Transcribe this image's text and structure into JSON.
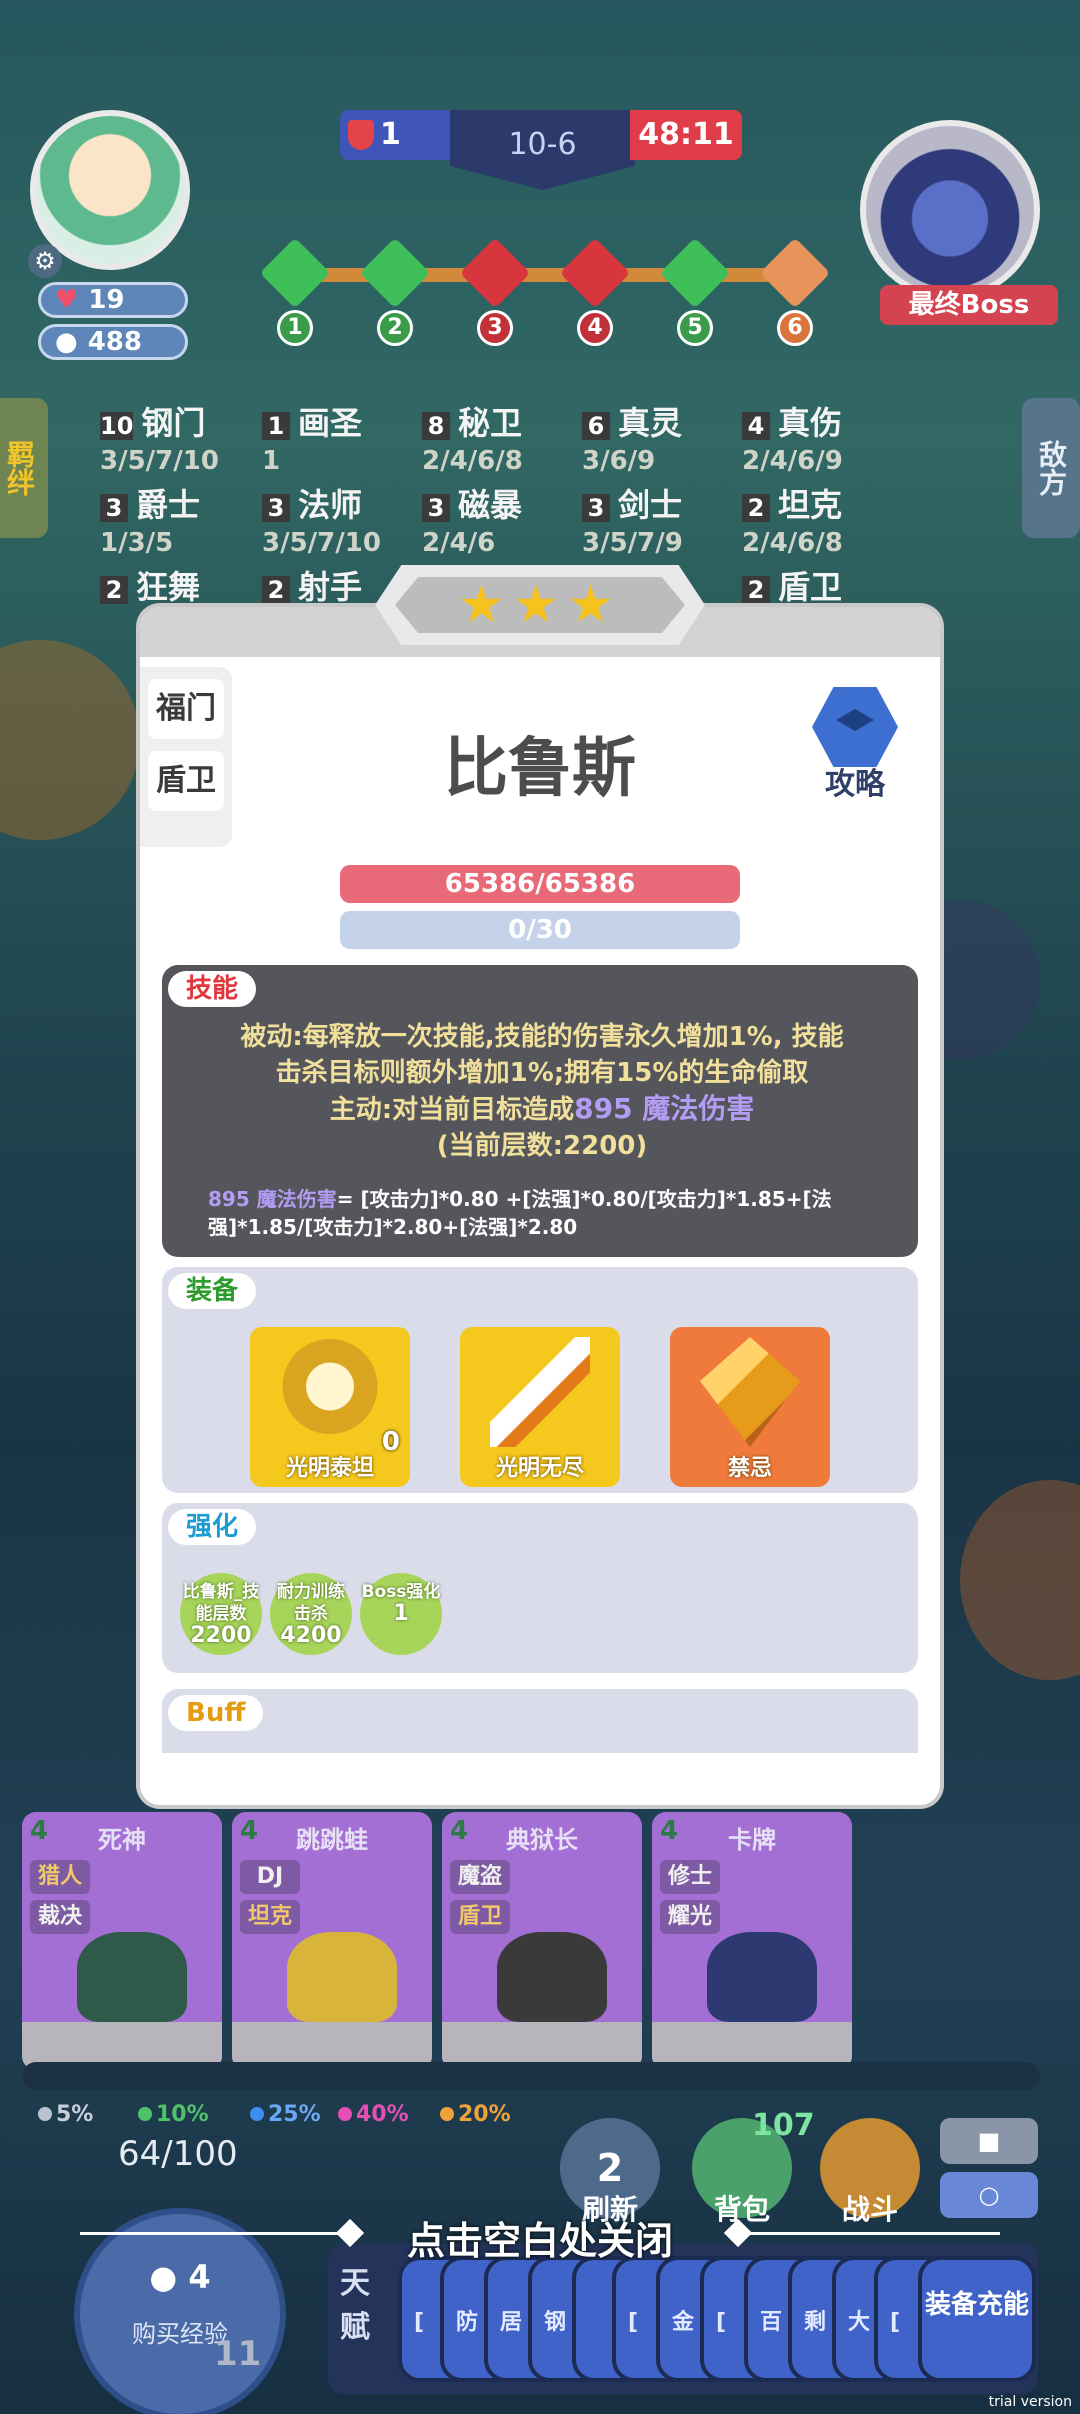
{
  "hud": {
    "player_hp": "19",
    "player_gold": "488",
    "score_left": "1",
    "stage": "10-6",
    "timer": "48:11",
    "boss_label": "最终Boss",
    "stages": [
      "1",
      "2",
      "3",
      "4",
      "5",
      "6"
    ]
  },
  "side_tabs": {
    "left": "羁绊",
    "right": "敌方"
  },
  "traits": [
    {
      "count": "10",
      "name": "钢门",
      "levels": "3/5/7/10"
    },
    {
      "count": "1",
      "name": "画圣",
      "levels": "1"
    },
    {
      "count": "8",
      "name": "秘卫",
      "levels": "2/4/6/8"
    },
    {
      "count": "6",
      "name": "真灵",
      "levels": "3/6/9"
    },
    {
      "count": "4",
      "name": "真伤",
      "levels": "2/4/6/9"
    },
    {
      "count": "3",
      "name": "爵士",
      "levels": "1/3/5"
    },
    {
      "count": "3",
      "name": "法师",
      "levels": "3/5/7/10"
    },
    {
      "count": "3",
      "name": "磁暴",
      "levels": "2/4/6"
    },
    {
      "count": "3",
      "name": "剑士",
      "levels": "3/5/7/9"
    },
    {
      "count": "2",
      "name": "坦克",
      "levels": "2/4/6/8"
    },
    {
      "count": "2",
      "name": "狂舞",
      "levels": ""
    },
    {
      "count": "2",
      "name": "射手",
      "levels": ""
    },
    {
      "count": "2",
      "name": "盾卫",
      "levels": ""
    }
  ],
  "modal": {
    "stars": "★★★",
    "role_tags": [
      "福门",
      "盾卫"
    ],
    "hero_name": "比鲁斯",
    "guide_label": "攻略",
    "hp": "65386/65386",
    "mana": "0/30",
    "skill": {
      "title": "技能",
      "passive_line1": "被动:每释放一次技能,技能的伤害永久增加1%, 技能",
      "passive_line2": "击杀目标则额外增加1%;拥有15%的生命偷取",
      "active_prefix": "主动:对当前目标造成",
      "active_damage": "895 魔法伤害",
      "stacks": "(当前层数:2200)",
      "formula_head": "895 魔法伤害",
      "formula_body": "= [攻击力]*0.80 +[法强]*0.80/[攻击力]*1.85+[法强]*1.85/[攻击力]*2.80+[法强]*2.80"
    },
    "equip": {
      "title": "装备",
      "items": [
        {
          "name": "光明泰坦",
          "qty": "0",
          "color": "#f4c81c"
        },
        {
          "name": "光明无尽",
          "qty": "",
          "color": "#f4c81c"
        },
        {
          "name": "禁忌",
          "qty": "",
          "color": "#f07a3c"
        }
      ]
    },
    "enhance": {
      "title": "强化",
      "chips": [
        {
          "label": "比鲁斯_技能层数",
          "value": "2200"
        },
        {
          "label": "耐力训练击杀",
          "value": "4200"
        },
        {
          "label": "Boss强化",
          "value": "1"
        }
      ]
    },
    "buff": {
      "title": "Buff"
    }
  },
  "bench": [
    {
      "cost": "4",
      "name": "死神",
      "tags": [
        "猎人",
        "裁决"
      ]
    },
    {
      "cost": "4",
      "name": "跳跳蛙",
      "tags": [
        "DJ",
        "坦克"
      ]
    },
    {
      "cost": "4",
      "name": "典狱长",
      "tags": [
        "魔盗",
        "盾卫"
      ]
    },
    {
      "cost": "4",
      "name": "卡牌",
      "tags": [
        "修士",
        "耀光"
      ]
    }
  ],
  "odds": [
    {
      "pct": "5%",
      "color": "#b9c3cf"
    },
    {
      "pct": "10%",
      "color": "#4fc36a"
    },
    {
      "pct": "25%",
      "color": "#3e8ef0"
    },
    {
      "pct": "40%",
      "color": "#e54fb5"
    },
    {
      "pct": "20%",
      "color": "#f0a23a"
    }
  ],
  "bottom": {
    "xp": "64/100",
    "buy_cost": "4",
    "buy_label": "购买经验",
    "level": "11",
    "refresh_cost": "2",
    "refresh_label": "刷新",
    "bag_count": "107",
    "bag_label": "背包",
    "fight_label": "战斗",
    "close_hint": "点击空白处关闭",
    "talent_label": "天赋",
    "talent_chips": [
      "[",
      "防",
      "居",
      "钢",
      "",
      "[",
      "金",
      "[",
      "百",
      "剩",
      "大",
      "["
    ],
    "equip_charge": "装备充能",
    "trial": "trial version"
  }
}
